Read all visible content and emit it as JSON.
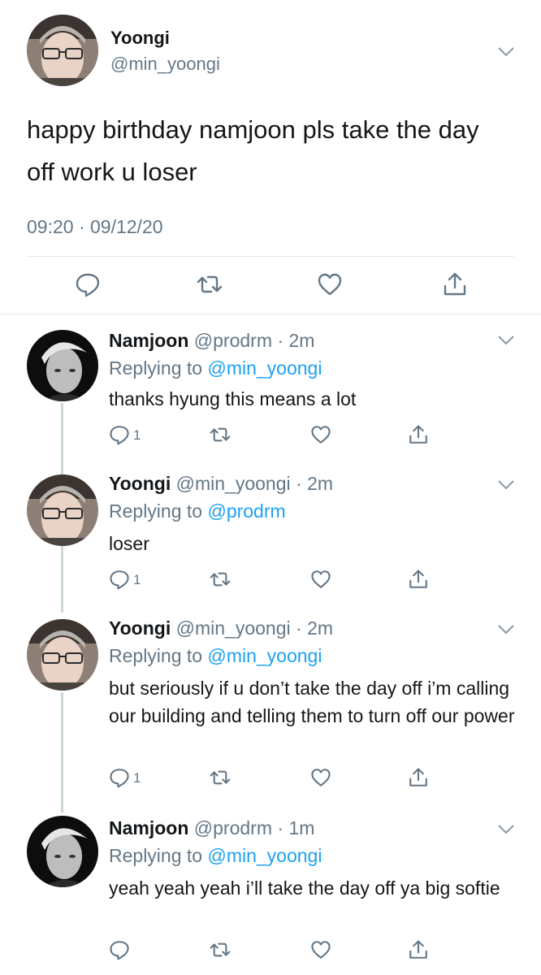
{
  "main_tweet": {
    "name": "Yoongi",
    "handle": "@min_yoongi",
    "text": "happy birthday namjoon pls take the day off work u loser",
    "timestamp": "09:20 · 09/12/20",
    "actions": [
      "reply-icon",
      "retweet-icon",
      "like-icon",
      "share-icon"
    ]
  },
  "replies": [
    {
      "name": "Namjoon",
      "handle": "@prodrm",
      "time": "2m",
      "replying_prefix": "Replying to ",
      "replying_to": "@min_yoongi",
      "text": "thanks hyung this means a lot",
      "reply_count": "1"
    },
    {
      "name": "Yoongi",
      "handle": "@min_yoongi",
      "time": "2m",
      "replying_prefix": "Replying to ",
      "replying_to": "@prodrm",
      "text": "loser",
      "reply_count": "1"
    },
    {
      "name": "Yoongi",
      "handle": "@min_yoongi",
      "time": "2m",
      "replying_prefix": "Replying to ",
      "replying_to": "@min_yoongi",
      "text": "but seriously if u don’t take the day off i’m calling our building and telling them to turn off our power",
      "reply_count": "1"
    },
    {
      "name": "Namjoon",
      "handle": "@prodrm",
      "time": "1m",
      "replying_prefix": "Replying to ",
      "replying_to": "@min_yoongi",
      "text": "yeah yeah yeah i’ll take the day off ya big softie",
      "reply_count": ""
    }
  ],
  "colors": {
    "text": "#14171a",
    "secondary": "#657786",
    "mention": "#1da1f2",
    "divider": "#e1e8ed",
    "thread_line": "#ccd6dd"
  }
}
